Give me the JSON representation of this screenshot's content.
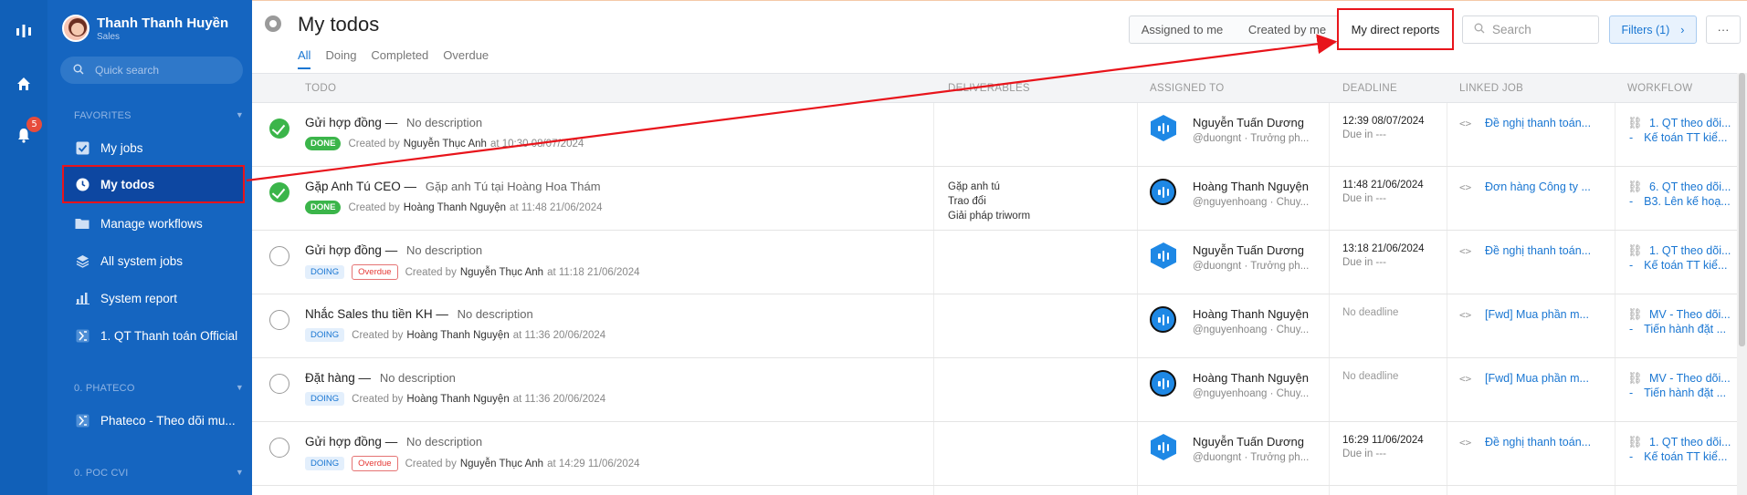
{
  "rail": {
    "notification_count": "5",
    "icons": [
      "logo-icon",
      "home-icon",
      "bell-icon"
    ]
  },
  "sidebar": {
    "user_name": "Thanh Thanh Huyền",
    "user_role": "Sales",
    "quick_search_placeholder": "Quick search",
    "favorites_label": "FAVORITES",
    "items": [
      {
        "label": "My jobs",
        "icon": "checkbox-icon"
      },
      {
        "label": "My todos",
        "icon": "clock-icon"
      },
      {
        "label": "Manage workflows",
        "icon": "folder-icon"
      },
      {
        "label": "All system jobs",
        "icon": "layers-icon"
      },
      {
        "label": "System report",
        "icon": "bar-chart-icon"
      },
      {
        "label": "1. QT Thanh toán Official",
        "icon": "workflow-icon"
      }
    ],
    "section2_label": "0. PHATECO",
    "section2_items": [
      {
        "label": "Phateco - Theo dõi mu...",
        "icon": "workflow-icon"
      }
    ],
    "section3_label": "0. POC CVI"
  },
  "header": {
    "title": "My todos",
    "tabs": [
      "All",
      "Doing",
      "Completed",
      "Overdue"
    ],
    "filter_buttons": [
      "Assigned to me",
      "Created by me",
      "My direct reports"
    ],
    "search_placeholder": "Search",
    "filters_label": "Filters (1)",
    "more_label": "···"
  },
  "table": {
    "columns": [
      "TODO",
      "DELIVERABLES",
      "ASSIGNED TO",
      "DEADLINE",
      "LINKED JOB",
      "WORKFLOW"
    ],
    "rows": [
      {
        "status": "done",
        "title": "Gửi hợp đồng —",
        "desc": "No description",
        "tags": [
          "DONE"
        ],
        "created_prefix": "Created by",
        "creator": "Nguyễn Thục Anh",
        "created_at": "at 10:30 08/07/2024",
        "deliverables": [],
        "assignee": "Nguyễn Tuấn Dương",
        "assignee_sub": "@duongnt · Trưởng ph...",
        "avatar": "hex",
        "deadline": "12:39 08/07/2024",
        "deadline_sub": "Due in ---",
        "linked_job": "Đề nghị thanh toán...",
        "wf1": "1. QT theo dõi...",
        "wf2": "Kế toán TT kiể..."
      },
      {
        "status": "done",
        "title": "Gặp Anh Tú CEO —",
        "desc": "Gặp anh Tú tại Hoàng Hoa Thám",
        "tags": [
          "DONE"
        ],
        "created_prefix": "Created by",
        "creator": "Hoàng Thanh Nguyện",
        "created_at": "at 11:48 21/06/2024",
        "deliverables": [
          "Gặp anh tú",
          "Trao đổi",
          "Giải pháp triworm"
        ],
        "assignee": "Hoàng Thanh Nguyện",
        "assignee_sub": "@nguyenhoang · Chuy...",
        "avatar": "circ",
        "deadline": "11:48 21/06/2024",
        "deadline_sub": "Due in ---",
        "linked_job": "Đơn hàng Công ty ...",
        "wf1": "6. QT theo dõi...",
        "wf2": "B3. Lên kế hoạ..."
      },
      {
        "status": "open",
        "title": "Gửi hợp đồng —",
        "desc": "No description",
        "tags": [
          "DOING",
          "Overdue"
        ],
        "created_prefix": "Created by",
        "creator": "Nguyễn Thục Anh",
        "created_at": "at 11:18 21/06/2024",
        "deliverables": [],
        "assignee": "Nguyễn Tuấn Dương",
        "assignee_sub": "@duongnt · Trưởng ph...",
        "avatar": "hex",
        "deadline": "13:18 21/06/2024",
        "deadline_sub": "Due in ---",
        "linked_job": "Đề nghị thanh toán...",
        "wf1": "1. QT theo dõi...",
        "wf2": "Kế toán TT kiể..."
      },
      {
        "status": "open",
        "title": "Nhắc Sales thu tiền KH —",
        "desc": "No description",
        "tags": [
          "DOING"
        ],
        "created_prefix": "Created by",
        "creator": "Hoàng Thanh Nguyện",
        "created_at": "at 11:36 20/06/2024",
        "deliverables": [],
        "assignee": "Hoàng Thanh Nguyện",
        "assignee_sub": "@nguyenhoang · Chuy...",
        "avatar": "circ",
        "deadline": "No deadline",
        "deadline_sub": "",
        "linked_job": "[Fwd] Mua phần m...",
        "wf1": "MV - Theo dõi...",
        "wf2": "Tiến hành đặt ..."
      },
      {
        "status": "open",
        "title": "Đặt hàng —",
        "desc": "No description",
        "tags": [
          "DOING"
        ],
        "created_prefix": "Created by",
        "creator": "Hoàng Thanh Nguyện",
        "created_at": "at 11:36 20/06/2024",
        "deliverables": [],
        "assignee": "Hoàng Thanh Nguyện",
        "assignee_sub": "@nguyenhoang · Chuy...",
        "avatar": "circ",
        "deadline": "No deadline",
        "deadline_sub": "",
        "linked_job": "[Fwd] Mua phần m...",
        "wf1": "MV - Theo dõi...",
        "wf2": "Tiến hành đặt ..."
      },
      {
        "status": "open",
        "title": "Gửi hợp đồng —",
        "desc": "No description",
        "tags": [
          "DOING",
          "Overdue"
        ],
        "created_prefix": "Created by",
        "creator": "Nguyễn Thục Anh",
        "created_at": "at 14:29 11/06/2024",
        "deliverables": [],
        "assignee": "Nguyễn Tuấn Dương",
        "assignee_sub": "@duongnt · Trưởng ph...",
        "avatar": "hex",
        "deadline": "16:29 11/06/2024",
        "deadline_sub": "Due in ---",
        "linked_job": "Đề nghị thanh toán...",
        "wf1": "1. QT theo dõi...",
        "wf2": "Kế toán TT kiể..."
      }
    ]
  },
  "annotation": {
    "color": "#e8141b"
  }
}
